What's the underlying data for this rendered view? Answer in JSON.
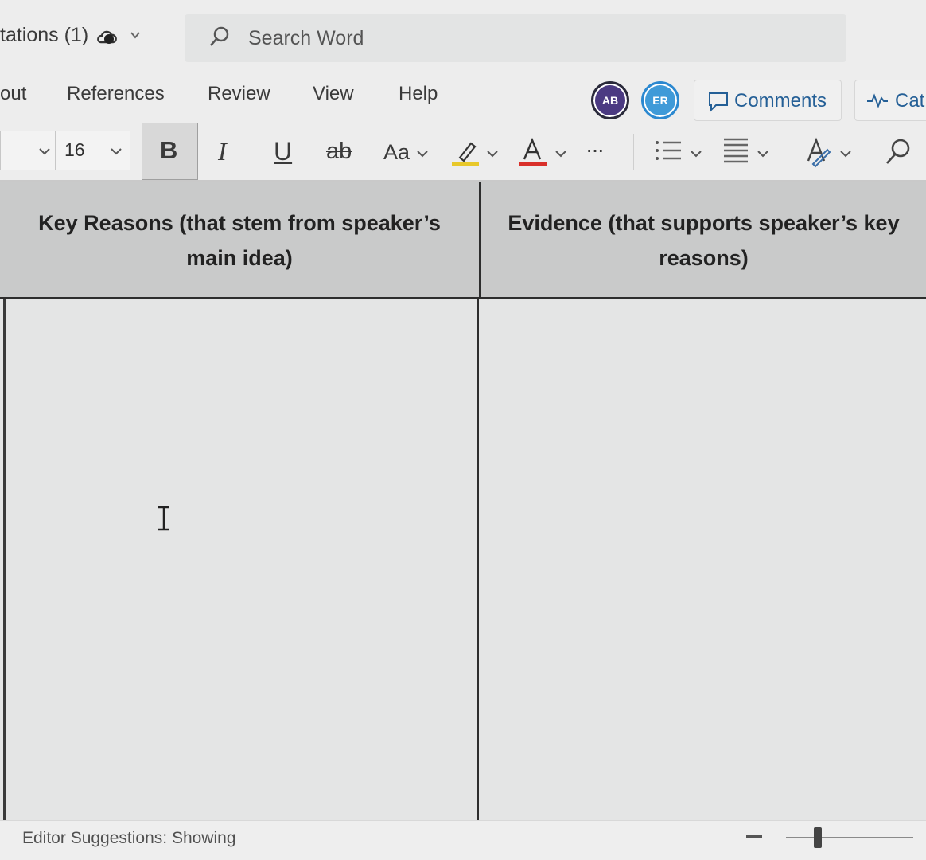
{
  "titlebar": {
    "doc_title": "tations (1)",
    "search_placeholder": "Search Word"
  },
  "tabs": [
    {
      "label": "out"
    },
    {
      "label": "References"
    },
    {
      "label": "Review"
    },
    {
      "label": "View"
    },
    {
      "label": "Help"
    }
  ],
  "collaborators": [
    {
      "initials": "AB",
      "color": "#4b3a82"
    },
    {
      "initials": "ER",
      "color": "#3f9ad8"
    }
  ],
  "header_buttons": {
    "comments_label": "Comments",
    "catchup_label": "Cat"
  },
  "toolbar": {
    "font_size": "16",
    "bold_label": "B",
    "italic_label": "I",
    "underline_label": "U",
    "strike_label": "ab",
    "change_case_label": "Aa",
    "more_label": "···",
    "highlight_color": "#e8c82a",
    "font_color": "#d9302a"
  },
  "table": {
    "headers": [
      "Key Reasons (that stem from speaker’s main idea)",
      "Evidence (that supports speaker’s key reasons)"
    ]
  },
  "statusbar": {
    "editor_suggestions": "Editor Suggestions: Showing",
    "zoom_level": 0.25
  }
}
